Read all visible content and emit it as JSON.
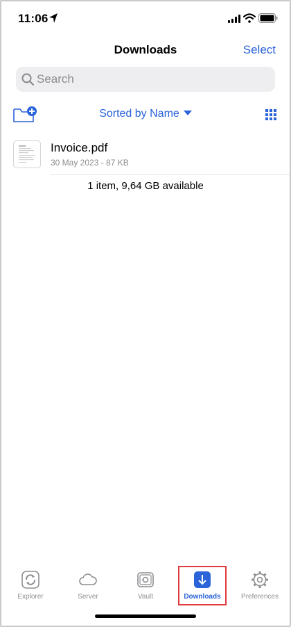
{
  "status_bar": {
    "time": "11:06"
  },
  "nav": {
    "title": "Downloads",
    "select_label": "Select"
  },
  "search": {
    "placeholder": "Search"
  },
  "toolbar": {
    "sort_label": "Sorted by Name"
  },
  "files": [
    {
      "name": "Invoice.pdf",
      "meta": "30 May 2023 - 87 KB"
    }
  ],
  "storage_info": "1 item, 9,64 GB available",
  "tabs": [
    {
      "label": "Explorer",
      "icon": "explorer-icon",
      "active": false
    },
    {
      "label": "Server",
      "icon": "cloud-icon",
      "active": false
    },
    {
      "label": "Vault",
      "icon": "vault-icon",
      "active": false
    },
    {
      "label": "Downloads",
      "icon": "download-icon",
      "active": true
    },
    {
      "label": "Preferences",
      "icon": "gear-icon",
      "active": false
    }
  ],
  "colors": {
    "accent": "#2b63d9",
    "highlight": "#e0393e",
    "inactive": "#8e8e92"
  }
}
